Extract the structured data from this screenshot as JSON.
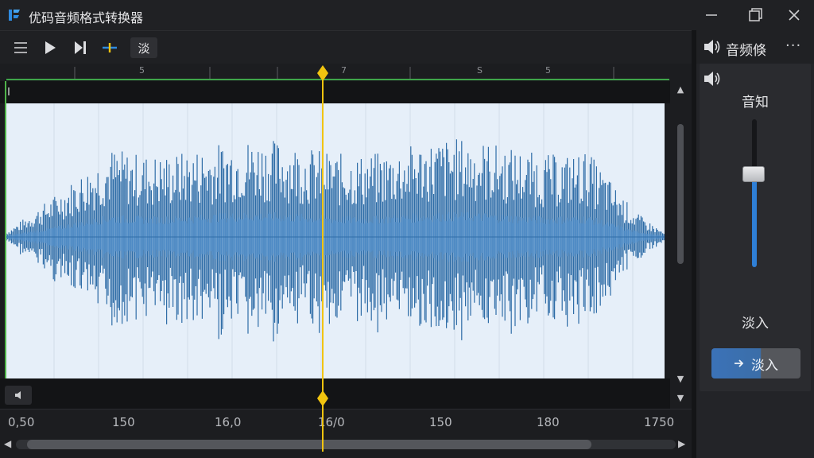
{
  "app": {
    "title": "优码音频格式转换器"
  },
  "toolbar": {
    "active_tool_label": "淡",
    "buttons": [
      "menu-icon",
      "play-icon",
      "next-icon",
      "split-icon"
    ]
  },
  "ruler": {
    "labels": [
      "5",
      "7",
      "S",
      "5"
    ]
  },
  "timeline": {
    "labels": [
      "0,50",
      "150",
      "16,0",
      "16/0",
      "150",
      "180",
      "1750"
    ]
  },
  "right_panel": {
    "title": "音频倏",
    "more": "···",
    "section_label": "音知",
    "fade_label": "淡入",
    "fade_button_label": "淡入",
    "volume_level": 0.63
  },
  "colors": {
    "waveform": "#2f6da7",
    "waveform_core": "#4d8ac5",
    "playhead": "#f1c40f",
    "accent": "#2f7fd6",
    "track_green": "#4fb34a"
  }
}
